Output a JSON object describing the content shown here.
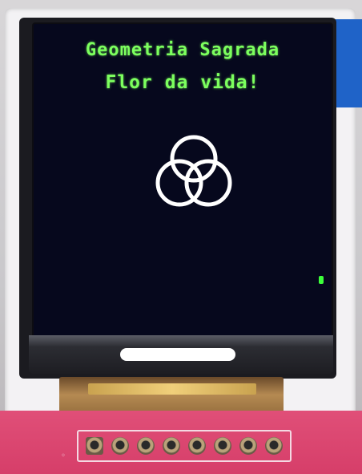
{
  "screen": {
    "line1": "Geometria Sagrada",
    "line2": "Flor da vida!",
    "text_color": "#7cff5e",
    "background_color": "#06081d",
    "symbol": "three-circle-trefoil-icon",
    "symbol_color": "#ffffff"
  },
  "device": {
    "pcb_color": "#d94470",
    "tape_color": "#1f63c8",
    "header_pins": 8
  }
}
